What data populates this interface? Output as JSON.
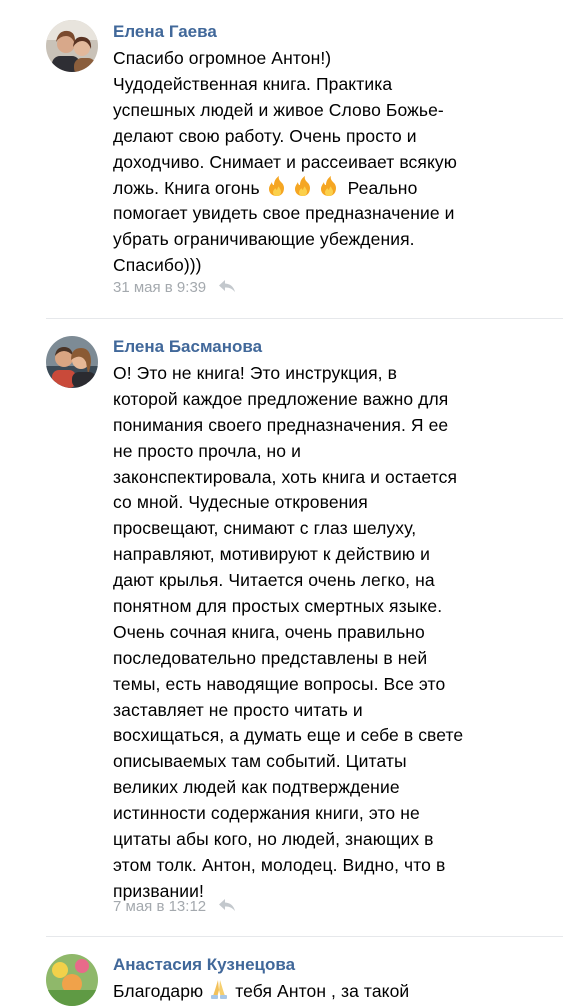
{
  "comments": [
    {
      "author": "Елена Гаева",
      "lines": [
        "Спасибо огромное Антон!)",
        "Чудодейственная книга. Практика",
        "успешных людей и живое Слово Божье-",
        "делают свою работу. Очень просто и",
        "доходчиво. Снимает и рассеивает всякую",
        "ложь. Книга огонь",
        "помогает увидеть свое предназначение и",
        "убрать ограничивающие убеждения.",
        "Спасибо)))"
      ],
      "line6_suffix": " Реально",
      "fire_emoji": "🔥🔥🔥",
      "timestamp": "31 мая в 9:39",
      "reply_icon": "reply-arrow-icon"
    },
    {
      "author": "Елена Басманова",
      "lines": [
        "О! Это не книга! Это инструкция, в",
        "которой каждое предложение важно для",
        "понимания своего предназначения. Я ее",
        "не просто прочла, но и",
        "законспектировала, хоть книга и остается",
        "со мной. Чудесные откровения",
        "просвещают, снимают с глаз шелуху,",
        "направляют, мотивируют к действию и",
        "дают крылья. Читается очень легко, на",
        "понятном для простых смертных языке.",
        "Очень сочная книга, очень правильно",
        "последовательно представлены в ней",
        "темы, есть наводящие вопросы. Все это",
        "заставляет не просто читать и",
        "восхищаться, а думать еще и себе в свете",
        "описываемых там событий. Цитаты",
        "великих людей как подтверждение",
        "истинности содержания книги, это не",
        "цитаты абы кого, но людей, знающих в",
        "этом толк. Антон, молодец. Видно, что в",
        "призвании!"
      ],
      "timestamp": "7 мая в 13:12",
      "reply_icon": "reply-arrow-icon"
    },
    {
      "author": "Анастасия Кузнецова",
      "first_line_prefix": "Благодарю",
      "pray_emoji": "🙏",
      "first_line_suffix": " тебя Антон , за такой"
    }
  ],
  "colors": {
    "author": "#41689a",
    "meta": "#a4a9ae",
    "divider": "#e6e8eb",
    "fire": "#f5a623"
  }
}
